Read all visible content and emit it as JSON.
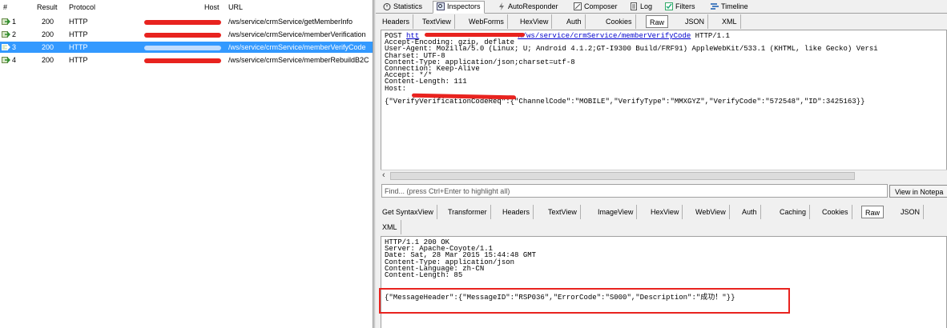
{
  "sessions": {
    "columns": {
      "num": "#",
      "result": "Result",
      "protocol": "Protocol",
      "host": "Host",
      "url": "URL"
    },
    "rows": [
      {
        "num": "1",
        "result": "200",
        "protocol": "HTTP",
        "url": "/ws/service/crmService/getMemberInfo"
      },
      {
        "num": "2",
        "result": "200",
        "protocol": "HTTP",
        "url": "/ws/service/crmService/memberVerification"
      },
      {
        "num": "3",
        "result": "200",
        "protocol": "HTTP",
        "url": "/ws/service/crmService/memberVerifyCode"
      },
      {
        "num": "4",
        "result": "200",
        "protocol": "HTTP",
        "url": "/ws/service/crmService/memberRebuildB2C"
      }
    ]
  },
  "inspector": {
    "top_tabs": [
      "Statistics",
      "Inspectors",
      "AutoResponder",
      "Composer",
      "Log",
      "Filters",
      "Timeline"
    ],
    "active_top_tab": "Inspectors",
    "request_tabs": [
      "Headers",
      "TextView",
      "WebForms",
      "HexView",
      "Auth",
      "Cookies",
      "Raw",
      "JSON",
      "XML"
    ],
    "active_request_tab": "Raw",
    "request": {
      "method": "POST ",
      "url_visible_prefix": "htt",
      "url_visible_suffix": "n/ws/service/crmService/memberVerifyCode",
      "http_version": " HTTP/1.1",
      "headers": [
        "Accept-Encoding: gzip, deflate",
        "User-Agent: Mozilla/5.0 (Linux; U; Android 4.1.2;GT-I9300 Build/FRF91) AppleWebKit/533.1 (KHTML, like Gecko) Versi",
        "Charset: UTF-8",
        "Content-Type: application/json;charset=utf-8",
        "Connection: Keep-Alive",
        "Accept: */*",
        "Content-Length: 111",
        "Host: "
      ],
      "body": "{\"VerifyVerificationCodeReq\":{\"ChannelCode\":\"MOBILE\",\"VerifyType\":\"MMXGYZ\",\"VerifyCode\":\"572548\",\"ID\":3425163}}"
    },
    "find_placeholder": "Find... (press Ctrl+Enter to highlight all)",
    "view_in_notepad": "View in Notepa",
    "response_tabs": [
      "Get SyntaxView",
      "Transformer",
      "Headers",
      "TextView",
      "ImageView",
      "HexView",
      "WebView",
      "Auth",
      "Caching",
      "Cookies",
      "Raw",
      "JSON"
    ],
    "response_tabs_row2": [
      "XML"
    ],
    "active_response_tab": "Raw",
    "response": {
      "headers": [
        "HTTP/1.1 200 OK",
        "Server: Apache-Coyote/1.1",
        "Date: Sat, 28 Mar 2015 15:44:48 GMT",
        "Content-Type: application/json",
        "Content-Language: zh-CN",
        "Content-Length: 85"
      ],
      "body": "{\"MessageHeader\":{\"MessageID\":\"RSP036\",\"ErrorCode\":\"S000\",\"Description\":\"成功！\"}}"
    }
  },
  "colors": {
    "selected_row": "#3399ff",
    "annotation_red": "#e8231f",
    "link_blue": "#0000cc"
  }
}
